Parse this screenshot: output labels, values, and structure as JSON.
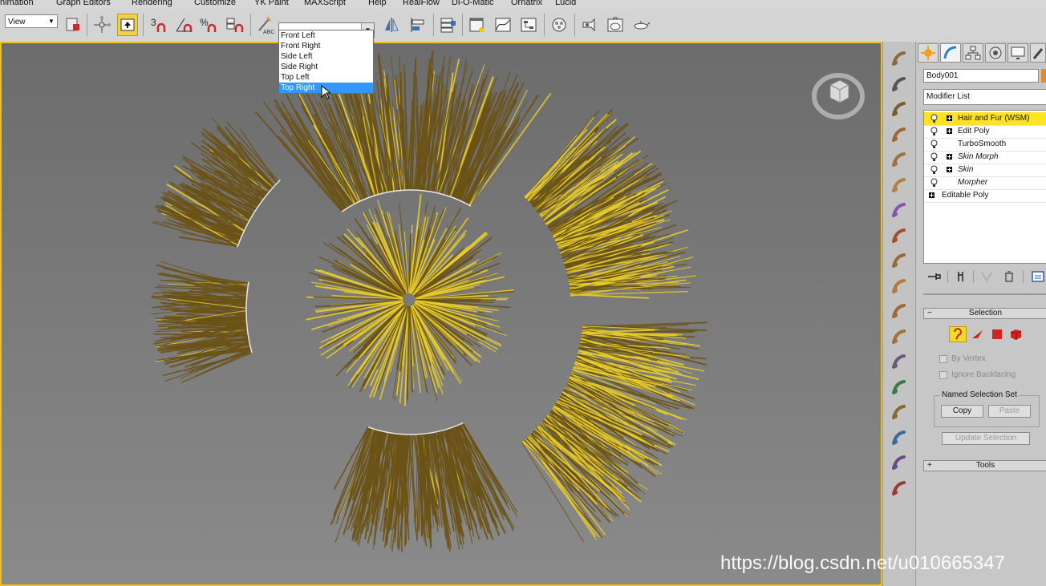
{
  "menu": {
    "items": [
      "nimation",
      "Graph Editors",
      "Rendering",
      "Customize",
      "YK Paint",
      "MAXScript",
      "Help",
      "RealFlow",
      "Di-O-Matic",
      "Ornatrix",
      "Lucid"
    ]
  },
  "toolbar": {
    "view_select_value": "View",
    "named_selection_value": "",
    "named_selection_options": [
      "Front Left",
      "Front Right",
      "Side Left",
      "Side Right",
      "Top Left",
      "Top Right"
    ],
    "named_selection_selected": "Top Right"
  },
  "panel": {
    "object_name": "Body001",
    "object_color": "#e28a2c",
    "modifier_list_label": "Modifier List",
    "stack": [
      {
        "label": "Hair and Fur (WSM)",
        "expand": true,
        "italic": false,
        "selected": true,
        "bulb": true
      },
      {
        "label": "Edit Poly",
        "expand": true,
        "italic": false,
        "selected": false,
        "bulb": true
      },
      {
        "label": "TurboSmooth",
        "expand": false,
        "italic": false,
        "selected": false,
        "bulb": true
      },
      {
        "label": "Skin Morph",
        "expand": true,
        "italic": true,
        "selected": false,
        "bulb": true
      },
      {
        "label": "Skin",
        "expand": true,
        "italic": true,
        "selected": false,
        "bulb": true
      },
      {
        "label": "Morpher",
        "expand": false,
        "italic": true,
        "selected": false,
        "bulb": true
      },
      {
        "label": "Editable Poly",
        "expand": true,
        "italic": false,
        "selected": false,
        "bulb": false
      }
    ],
    "selection": {
      "title": "Selection",
      "collapse_sign": "−",
      "by_vertex": "By Vertex",
      "ignore_backfacing": "Ignore Backfacing",
      "named_sets": "Named Selection Set",
      "copy": "Copy",
      "paste": "Paste",
      "update": "Update Selection"
    },
    "tools": {
      "title": "Tools",
      "expand_sign": "+"
    }
  },
  "colors": {
    "viewport_border": "#e8c21a",
    "selected_modifier": "#fde324",
    "dropdown_highlight": "#3297fd",
    "hair_dark": "#6b5216",
    "hair_light": "#e8cc2a"
  },
  "watermark": "https://blog.csdn.net/u010665347"
}
